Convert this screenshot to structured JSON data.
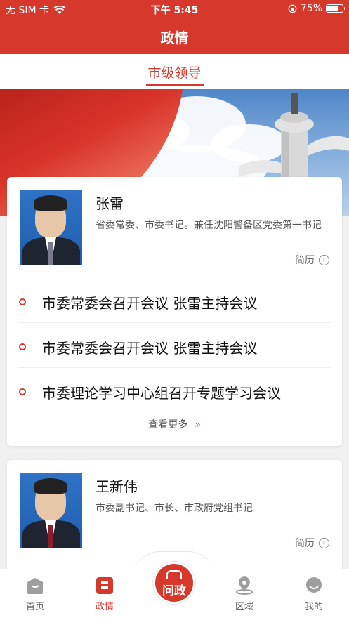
{
  "status_bar": {
    "carrier": "无 SIM 卡",
    "time": "下午 5:45",
    "battery_percent": "75%",
    "battery_level": 0.75
  },
  "header": {
    "title": "政情"
  },
  "subtab": {
    "label": "市级领导"
  },
  "leaders": [
    {
      "name": "张雷",
      "description": "省委常委、市委书记。兼任沈阳警备区党委第一书记",
      "resume_label": "简历",
      "news": [
        "市委常委会召开会议  张雷主持会议",
        "市委常委会召开会议  张雷主持会议",
        "市委理论学习中心组召开专题学习会议"
      ],
      "more_label": "查看更多"
    },
    {
      "name": "王新伟",
      "description": "市委副书记、市长、市政府党组书记",
      "resume_label": "简历"
    }
  ],
  "bottom_nav": {
    "items": [
      {
        "label": "首页",
        "icon": "home-icon"
      },
      {
        "label": "政情",
        "icon": "politics-icon",
        "active": true
      },
      {
        "label": "问政",
        "icon": "ask-government-icon"
      },
      {
        "label": "区域",
        "icon": "location-pin-icon"
      },
      {
        "label": "我的",
        "icon": "profile-icon"
      }
    ]
  },
  "colors": {
    "brand": "#d7382c"
  }
}
